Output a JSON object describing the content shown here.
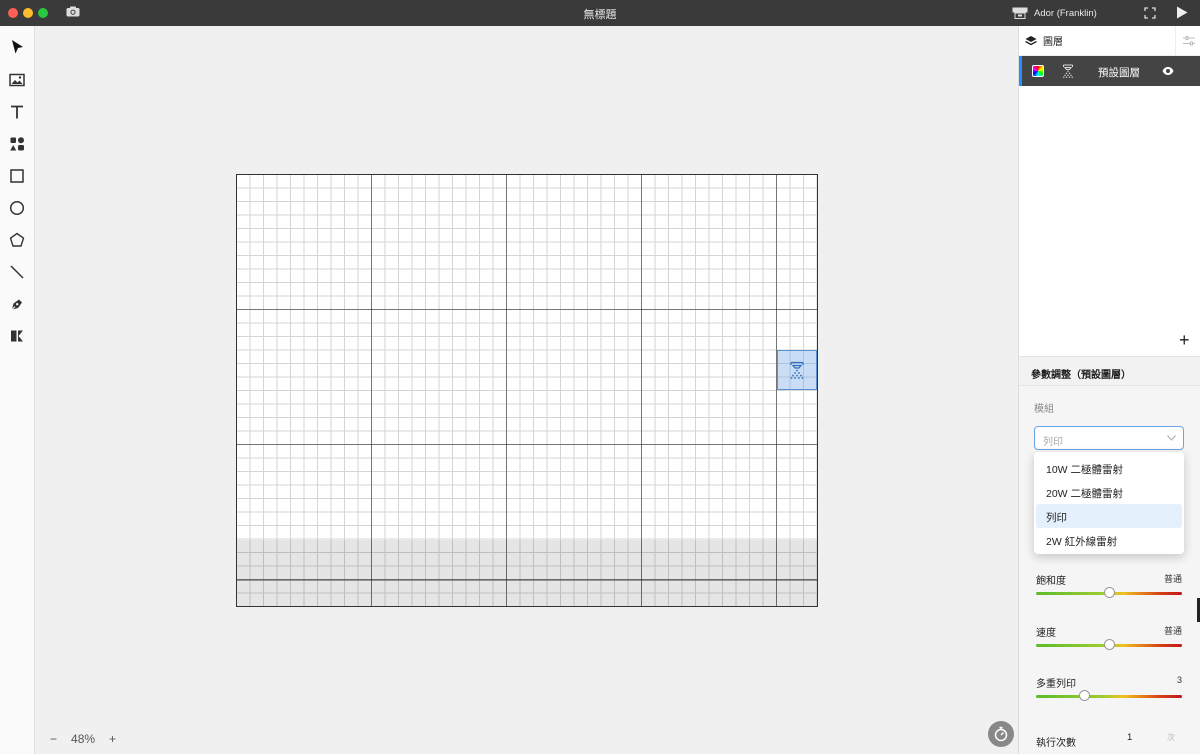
{
  "window": {
    "title": "無標題",
    "machine_name": "Ador (Franklin)"
  },
  "toolbar": {
    "tools": [
      "select-tool",
      "image-tool",
      "text-tool",
      "element-tool",
      "rectangle-tool",
      "ellipse-tool",
      "polygon-tool",
      "line-tool",
      "pen-tool",
      "dmkt-tool"
    ]
  },
  "canvas": {
    "zoom_minus": "−",
    "zoom_value": "48%",
    "zoom_plus": "+"
  },
  "layers": {
    "title": "圖層",
    "items": [
      {
        "name": "預設圖層"
      }
    ],
    "add_label": "+"
  },
  "params": {
    "title": "參數調整（預設圖層）",
    "module_label": "模組",
    "module_selected": "列印",
    "module_options": [
      "10W 二極體雷射",
      "20W 二極體雷射",
      "列印",
      "2W 紅外線雷射"
    ],
    "sliders": [
      {
        "label": "飽和度",
        "value": "普通",
        "level": 0.5
      },
      {
        "label": "速度",
        "value": "普通",
        "level": 0.5
      },
      {
        "label": "多重列印",
        "value": "3",
        "level": 0.33
      }
    ],
    "run_label": "執行次數",
    "run_value": "1",
    "run_unit": "次"
  },
  "colors": {
    "accent": "#1e90ff",
    "titlebar": "#3a3a3a",
    "layer_selected": "#444444"
  }
}
